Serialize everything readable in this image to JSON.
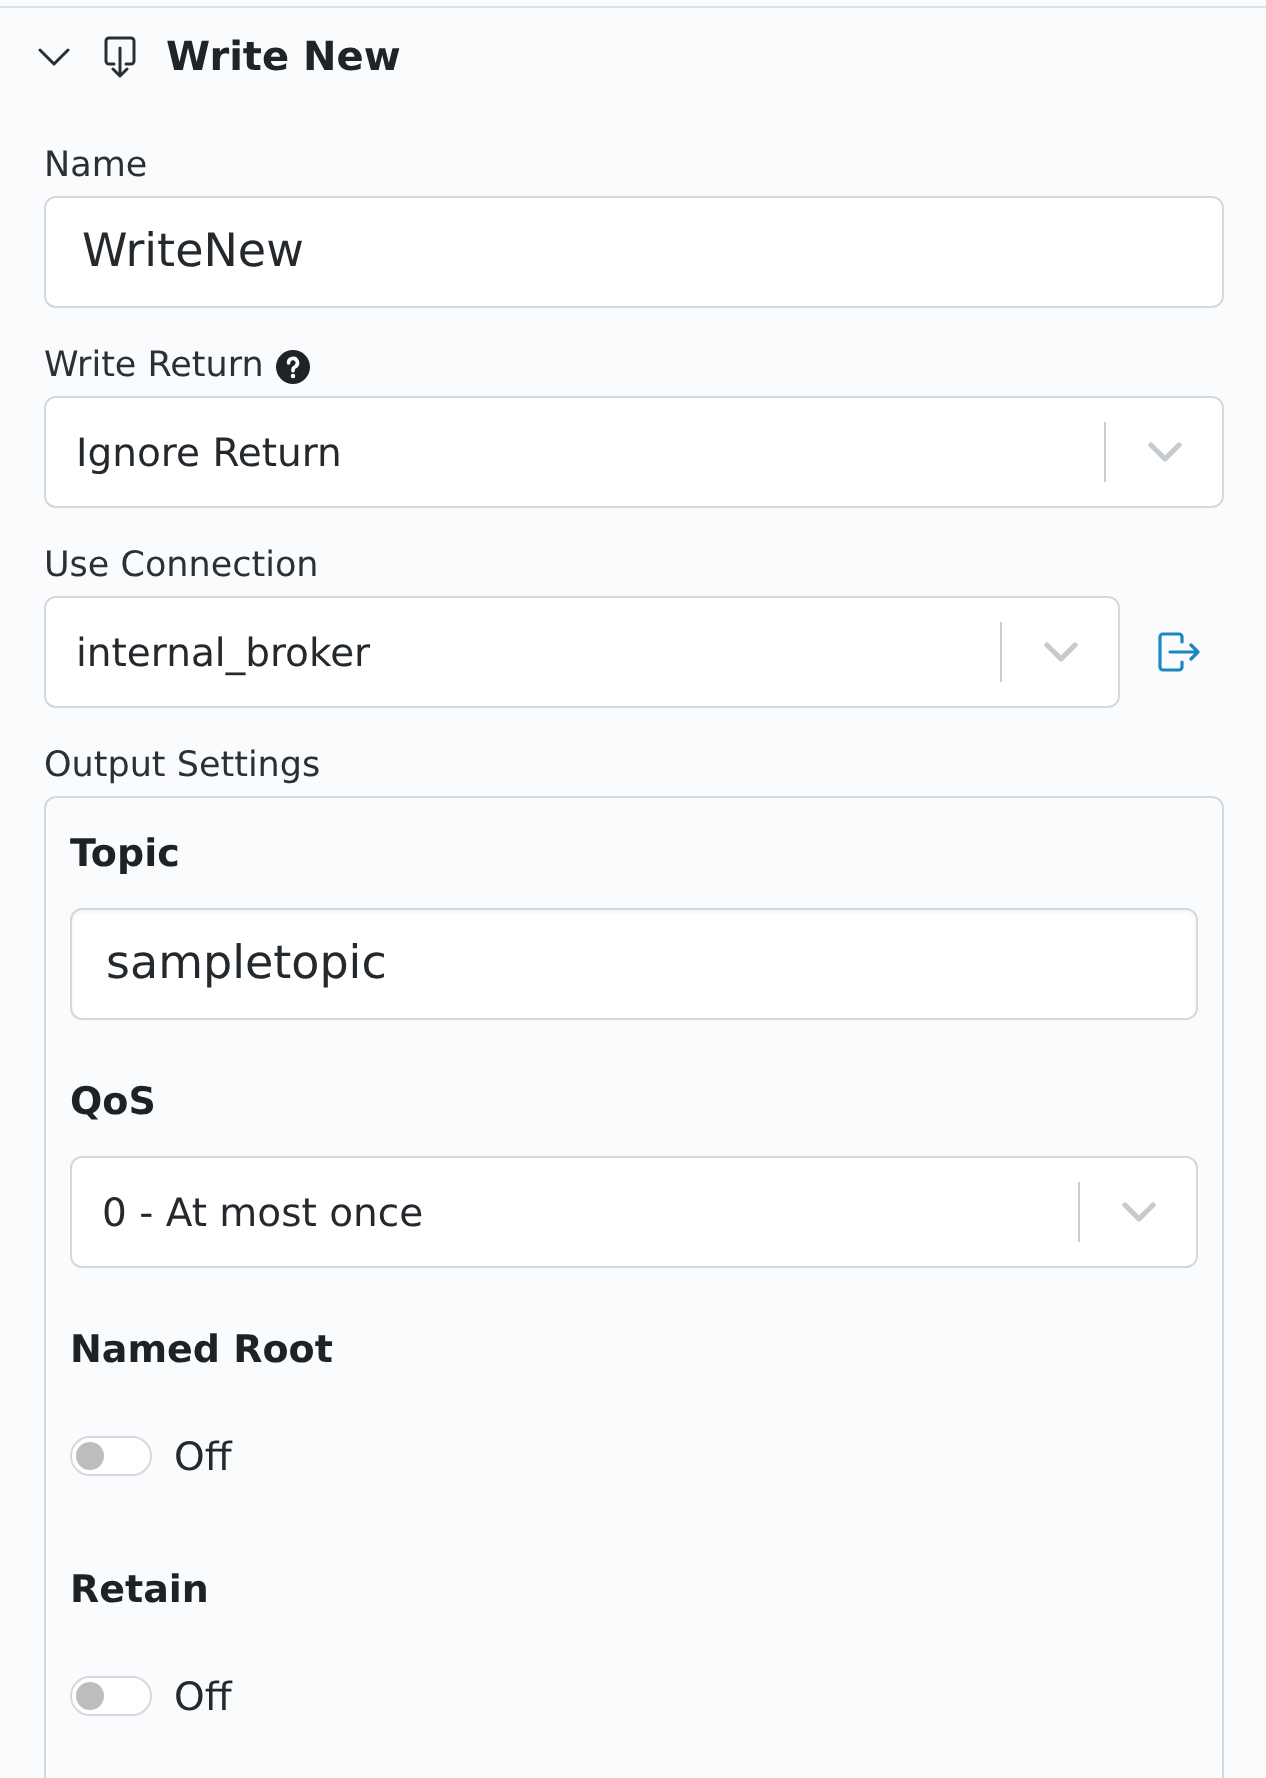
{
  "section": {
    "title": "Write New",
    "expanded": true
  },
  "fields": [
    {
      "kind": "text",
      "label": "Name",
      "value": "WriteNew"
    },
    {
      "kind": "select",
      "label": "Write Return",
      "help": true,
      "value": "Ignore Return"
    },
    {
      "kind": "select",
      "label": "Use Connection",
      "value": "internal_broker",
      "open_link": true
    }
  ],
  "output_settings": {
    "label": "Output Settings",
    "fields": [
      {
        "kind": "text",
        "label": "Topic",
        "value": "sampletopic"
      },
      {
        "kind": "select",
        "label": "QoS",
        "value": "0 - At most once"
      },
      {
        "kind": "toggle",
        "label": "Named Root",
        "on": false,
        "state_text": "Off"
      },
      {
        "kind": "toggle",
        "label": "Retain",
        "on": false,
        "state_text": "Off"
      }
    ]
  }
}
